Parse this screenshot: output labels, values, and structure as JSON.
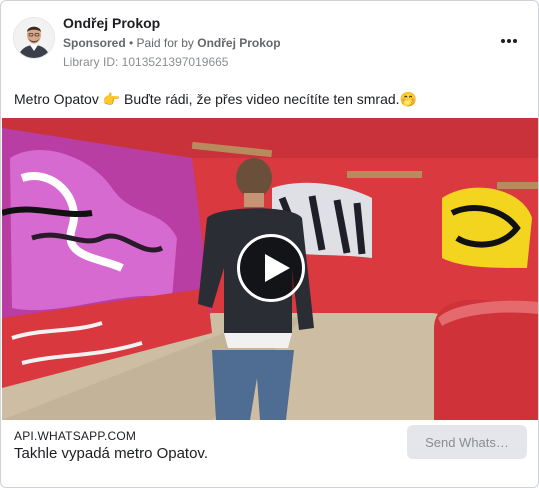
{
  "post": {
    "advertiser_name": "Ondřej Prokop",
    "sponsored_label": "Sponsored",
    "paid_for_prefix": " • Paid for by ",
    "paid_for_by": "Ondřej Prokop",
    "library_id": "Library ID: 1013521397019665",
    "caption": "Metro Opatov 👉 Buďte rádi, že přes video necítíte ten smrad.🤭",
    "more_icon": "more-horizontal-icon"
  },
  "link_preview": {
    "domain": "API.WHATSAPP.COM",
    "headline": "Takhle vypadá metro Opatov.",
    "cta_label": "Send Whats…"
  },
  "colors": {
    "text_primary": "#1c1e21",
    "text_secondary": "#65676b",
    "cta_bg": "#e4e6eb",
    "graffiti_wall": "#d8313a"
  }
}
